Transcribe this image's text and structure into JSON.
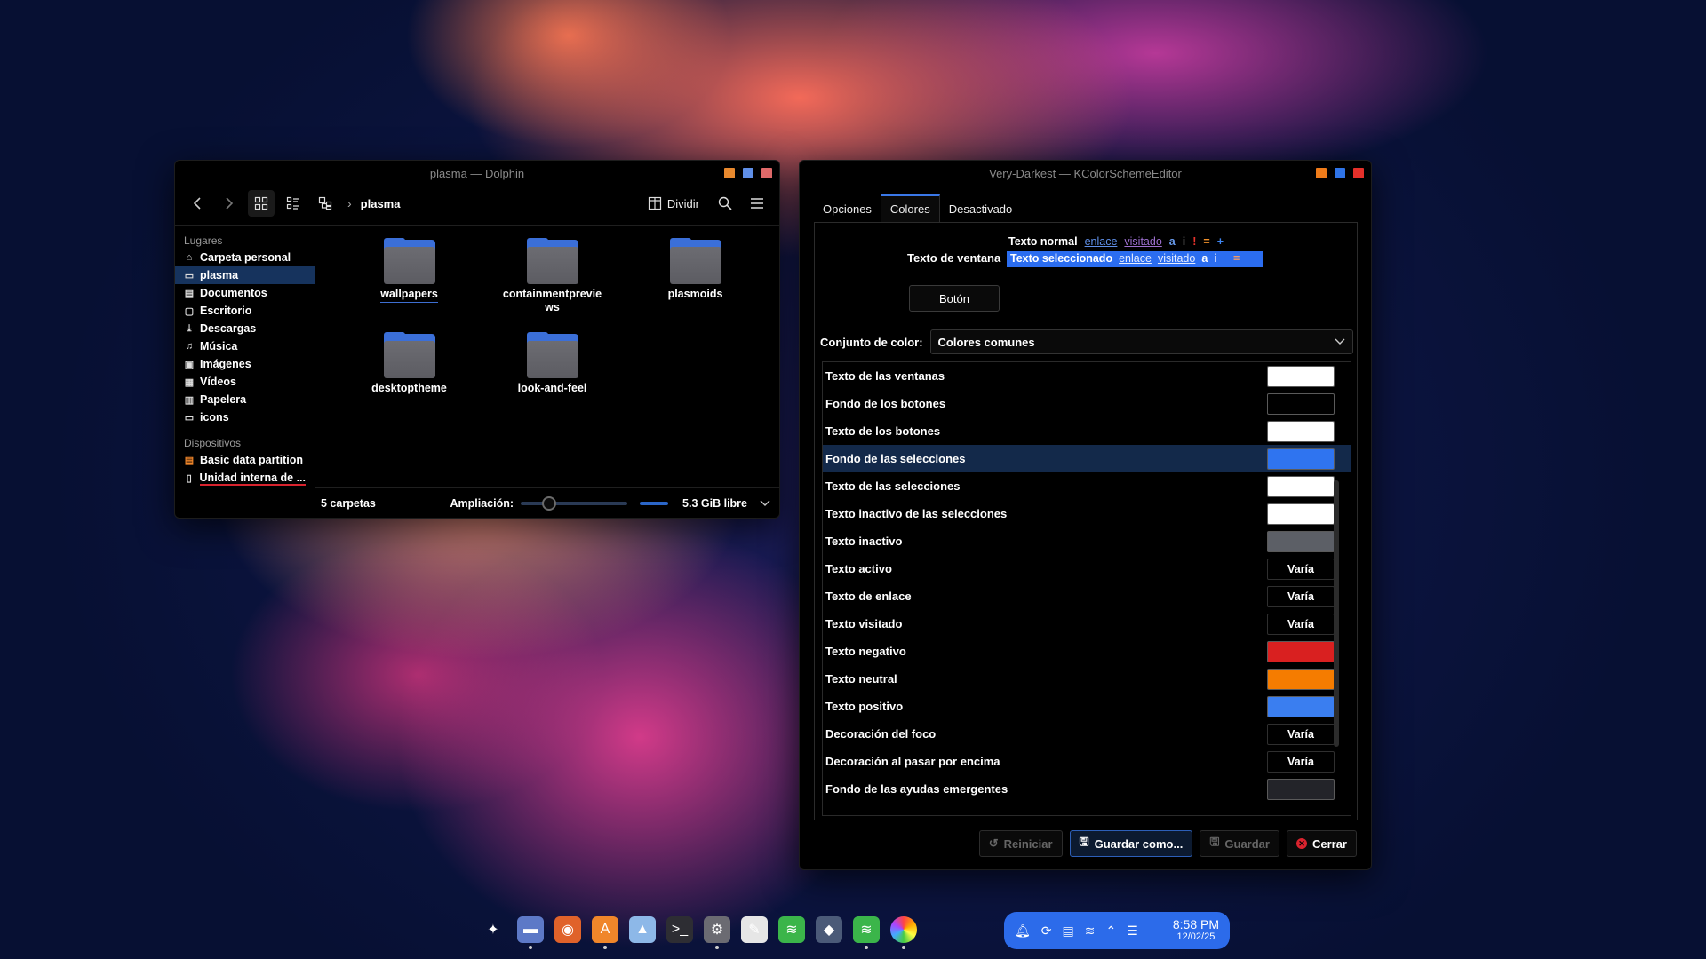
{
  "dolphin": {
    "title": "plasma — Dolphin",
    "title_buttons": [
      "#e8892e",
      "#5f8fe8",
      "#e36b6b"
    ],
    "breadcrumb": "plasma",
    "split_label": "Dividir",
    "places_header": "Lugares",
    "places": [
      {
        "label": "Carpeta personal",
        "icon": "home-icon"
      },
      {
        "label": "plasma",
        "icon": "folder-icon",
        "selected": true
      },
      {
        "label": "Documentos",
        "icon": "document-icon"
      },
      {
        "label": "Escritorio",
        "icon": "desktop-icon"
      },
      {
        "label": "Descargas",
        "icon": "download-icon"
      },
      {
        "label": "Música",
        "icon": "music-icon"
      },
      {
        "label": "Imágenes",
        "icon": "image-icon"
      },
      {
        "label": "Vídeos",
        "icon": "video-icon"
      },
      {
        "label": "Papelera",
        "icon": "trash-icon"
      },
      {
        "label": "icons",
        "icon": "folder-icon"
      }
    ],
    "devices_header": "Dispositivos",
    "devices": [
      {
        "label": "Basic data partition",
        "icon": "drive-icon"
      },
      {
        "label": "Unidad interna de ...",
        "icon": "drive-icon"
      }
    ],
    "files": [
      "wallpapers",
      "containmentpreviews",
      "plasmoids",
      "desktoptheme",
      "look-and-feel"
    ],
    "status_count": "5 carpetas",
    "zoom_label": "Ampliación:",
    "free_space": "5.3 GiB libre"
  },
  "editor": {
    "title": "Very-Darkest — KColorSchemeEditor",
    "title_buttons": [
      "#f07c1a",
      "#2f74e8",
      "#e5302a"
    ],
    "tabs": [
      "Opciones",
      "Colores",
      "Desactivado"
    ],
    "preview": {
      "window_text_label": "Texto de ventana",
      "normal_text": "Texto normal",
      "selected_text": "Texto seleccionado",
      "link": "enlace",
      "visited": "visitado",
      "active": "a",
      "inactive": "i",
      "negative": "!",
      "neutral": "=",
      "positive": "+",
      "button": "Botón"
    },
    "color_set_label": "Conjunto de color:",
    "color_set_value": "Colores comunes",
    "roles": [
      {
        "label": "Texto de las ventanas",
        "color": "#ffffff"
      },
      {
        "label": "Fondo de los botones",
        "color": "#000000"
      },
      {
        "label": "Texto de los botones",
        "color": "#ffffff"
      },
      {
        "label": "Fondo de las selecciones",
        "color": "#2f74f0",
        "selected": true
      },
      {
        "label": "Texto de las selecciones",
        "color": "#ffffff"
      },
      {
        "label": "Texto inactivo de las selecciones",
        "color": "#ffffff"
      },
      {
        "label": "Texto inactivo",
        "color": "#5c5f66"
      },
      {
        "label": "Texto activo",
        "varies": "Varía"
      },
      {
        "label": "Texto de enlace",
        "varies": "Varía"
      },
      {
        "label": "Texto visitado",
        "varies": "Varía"
      },
      {
        "label": "Texto negativo",
        "color": "#d92020"
      },
      {
        "label": "Texto neutral",
        "color": "#f57c00"
      },
      {
        "label": "Texto positivo",
        "color": "#3a7ef0"
      },
      {
        "label": "Decoración del foco",
        "varies": "Varía"
      },
      {
        "label": "Decoración al pasar por encima",
        "varies": "Varía"
      },
      {
        "label": "Fondo de las ayudas emergentes",
        "color": "#232429"
      }
    ],
    "buttons": {
      "reset": "Reiniciar",
      "save_as": "Guardar como...",
      "save": "Guardar",
      "close": "Cerrar"
    }
  },
  "taskbar": {
    "apps": [
      {
        "name": "launcher-icon",
        "glyph": "✦",
        "bg": "transparent"
      },
      {
        "name": "dolphin-icon",
        "glyph": "▬",
        "bg": "#5d79c7",
        "running": true
      },
      {
        "name": "firefox-icon",
        "glyph": "◉",
        "bg": "#e0622a"
      },
      {
        "name": "software-store-icon",
        "glyph": "A",
        "bg": "#f0862a",
        "running": true
      },
      {
        "name": "image-viewer-icon",
        "glyph": "▲",
        "bg": "#8db8e8"
      },
      {
        "name": "terminal-icon",
        "glyph": ">_",
        "bg": "#2d2d33"
      },
      {
        "name": "settings-icon",
        "glyph": "⚙",
        "bg": "#6b6b72",
        "running": true
      },
      {
        "name": "text-editor-icon",
        "glyph": "✎",
        "bg": "#e6e6e6"
      },
      {
        "name": "spotify-icon",
        "glyph": "≋",
        "bg": "#3bb54a"
      },
      {
        "name": "app-icon",
        "glyph": "◆",
        "bg": "#4b5a78"
      },
      {
        "name": "spotify-icon-2",
        "glyph": "≋",
        "bg": "#3bb54a",
        "running": true
      },
      {
        "name": "color-scheme-icon",
        "glyph": "●",
        "bg": "transparent",
        "running": true
      }
    ],
    "tray_icons": [
      "bell-icon",
      "sync-icon",
      "clipboard-icon",
      "wifi-icon",
      "chevron-up-icon",
      "sliders-icon"
    ],
    "time": "8:58 PM",
    "date": "12/02/25",
    "tray_color": "#2c6bea"
  }
}
